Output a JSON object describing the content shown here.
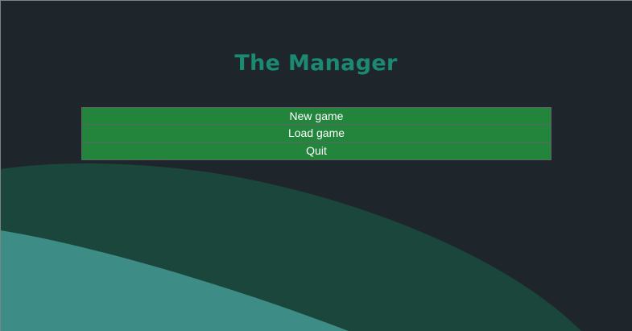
{
  "title": "The Manager",
  "menu": {
    "new_game": "New game",
    "load_game": "Load game",
    "quit": "Quit"
  },
  "colors": {
    "background": "#1f262b",
    "title": "#1c8a72",
    "button": "#22853b",
    "wave_dark": "#1b463c",
    "wave_light": "#3d8c85"
  }
}
